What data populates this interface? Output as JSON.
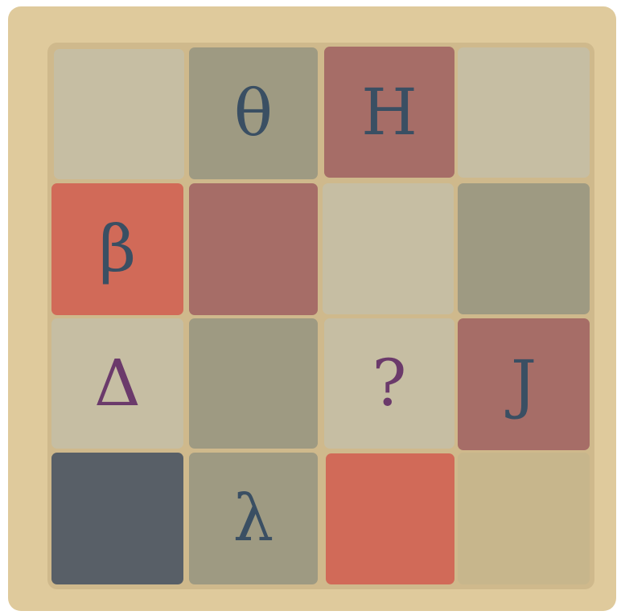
{
  "puzzle": {
    "rows": [
      [
        {
          "symbol": "",
          "color": "#c6bea3",
          "symbol_color": "#3a4f63"
        },
        {
          "symbol": "θ",
          "color": "#9e9a82",
          "symbol_color": "#3a4f63"
        },
        {
          "symbol": "H",
          "color": "#a66d67",
          "symbol_color": "#3a4f63"
        },
        {
          "symbol": "",
          "color": "#c6bea3",
          "symbol_color": "#3a4f63"
        }
      ],
      [
        {
          "symbol": "β",
          "color": "#d16a58",
          "symbol_color": "#3a4f63"
        },
        {
          "symbol": "",
          "color": "#a66d67",
          "symbol_color": "#3a4f63"
        },
        {
          "symbol": "",
          "color": "#c6bea3",
          "symbol_color": "#3a4f63"
        },
        {
          "symbol": "",
          "color": "#9e9a82",
          "symbol_color": "#3a4f63"
        }
      ],
      [
        {
          "symbol": "Δ",
          "color": "#c6bea3",
          "symbol_color": "#6b3a6b"
        },
        {
          "symbol": "",
          "color": "#9e9a82",
          "symbol_color": "#3a4f63"
        },
        {
          "symbol": "?",
          "color": "#c6bea3",
          "symbol_color": "#6b3a6b"
        },
        {
          "symbol": "J",
          "color": "#a66d67",
          "symbol_color": "#3a4f63"
        }
      ],
      [
        {
          "symbol": "",
          "color": "#585f67",
          "symbol_color": "#3a4f63"
        },
        {
          "symbol": "λ",
          "color": "#9e9a82",
          "symbol_color": "#3a4f63"
        },
        {
          "symbol": "",
          "color": "#d16a58",
          "symbol_color": "#3a4f63"
        },
        {
          "symbol": "",
          "color": "#c7b68c",
          "symbol_color": "#3a4f63",
          "blank": true
        }
      ]
    ]
  }
}
